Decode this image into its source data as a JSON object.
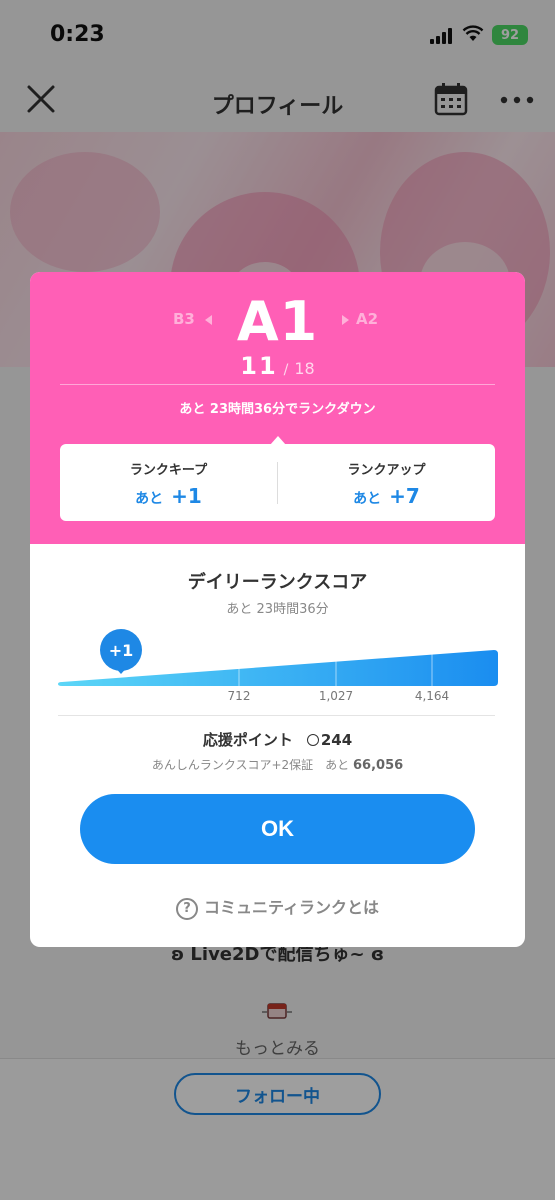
{
  "status_bar": {
    "time": "0:23",
    "battery": "92"
  },
  "nav": {
    "title": "プロフィール"
  },
  "background": {
    "live_text": "ʚ Live2Dで配信ちゅ~ ɞ",
    "more_text": "もっとみる",
    "follow_label": "フォロー中"
  },
  "modal": {
    "rank": {
      "prev": "B3",
      "current": "A1",
      "next": "A2",
      "position": "11",
      "total": "18",
      "down_text": "あと 23時間36分でランクダウン"
    },
    "keep": {
      "label": "ランクキープ",
      "prefix": "あと",
      "value": "+1"
    },
    "up": {
      "label": "ランクアップ",
      "prefix": "あと",
      "value": "+7"
    },
    "daily": {
      "title": "デイリーランクスコア",
      "remaining": "あと 23時間36分",
      "marker": "+1",
      "thresholds": [
        "712",
        "1,027",
        "4,164"
      ]
    },
    "support": {
      "label": "応援ポイント",
      "points": "244",
      "guarantee": "あんしんランクスコア+2保証　あと",
      "guarantee_value": "66,056"
    },
    "ok_label": "OK",
    "help_label": "コミュニティランクとは"
  },
  "colors": {
    "accent_pink": "#ff5fb6",
    "accent_blue": "#1a8df0"
  }
}
